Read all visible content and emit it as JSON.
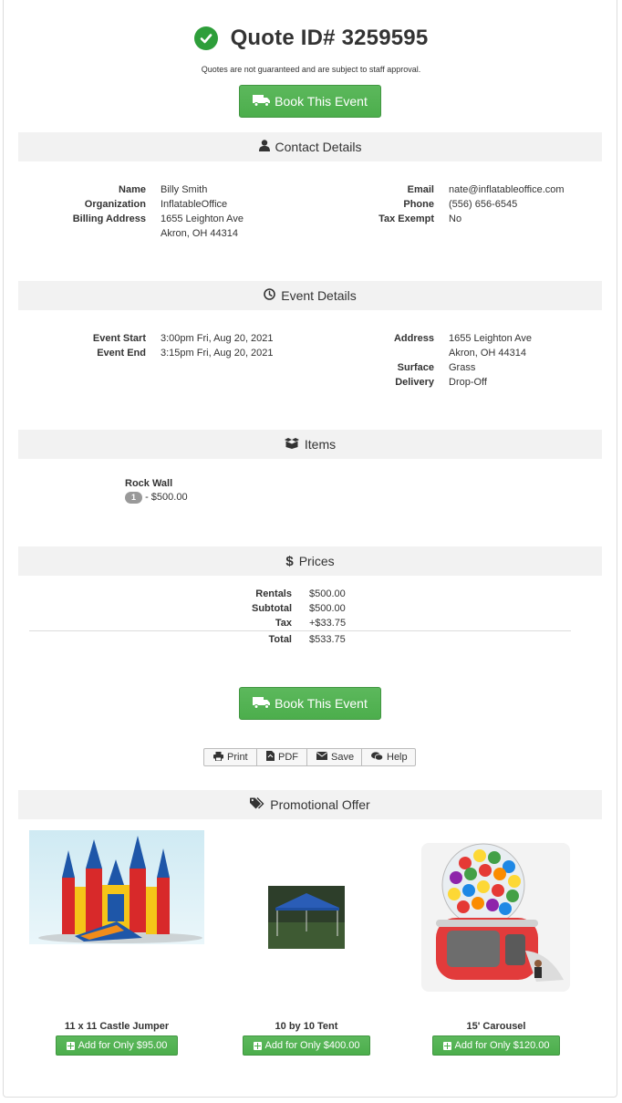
{
  "quote": {
    "title": "Quote ID# 3259595",
    "disclaimer": "Quotes are not guaranteed and are subject to staff approval.",
    "book_label": "Book This Event"
  },
  "contact": {
    "header": "Contact Details",
    "left": [
      {
        "label": "Name",
        "value": "Billy Smith"
      },
      {
        "label": "Organization",
        "value": "InflatableOffice"
      },
      {
        "label": "Billing Address",
        "value": "1655 Leighton Ave"
      },
      {
        "label": "",
        "value": "Akron, OH 44314"
      }
    ],
    "right": [
      {
        "label": "Email",
        "value": "nate@inflatableoffice.com"
      },
      {
        "label": "Phone",
        "value": "(556) 656-6545"
      },
      {
        "label": "Tax Exempt",
        "value": "No"
      }
    ]
  },
  "event": {
    "header": "Event Details",
    "left": [
      {
        "label": "Event Start",
        "value": "3:00pm Fri, Aug 20, 2021"
      },
      {
        "label": "Event End",
        "value": "3:15pm Fri, Aug 20, 2021"
      }
    ],
    "right": [
      {
        "label": "Address",
        "value": "1655 Leighton Ave"
      },
      {
        "label": "",
        "value": "Akron, OH 44314"
      },
      {
        "label": "Surface",
        "value": "Grass"
      },
      {
        "label": "Delivery",
        "value": "Drop-Off"
      }
    ]
  },
  "items": {
    "header": "Items",
    "list": [
      {
        "name": "Rock Wall",
        "qty": "1",
        "price": "- $500.00"
      }
    ]
  },
  "prices": {
    "header": "Prices",
    "rows": [
      {
        "label": "Rentals",
        "value": "$500.00"
      },
      {
        "label": "Subtotal",
        "value": "$500.00"
      },
      {
        "label": "Tax",
        "value": "+$33.75"
      }
    ],
    "total_label": "Total",
    "total_value": "$533.75"
  },
  "actions": {
    "print": "Print",
    "pdf": "PDF",
    "save": "Save",
    "help": "Help"
  },
  "promo": {
    "header": "Promotional Offer",
    "offers": [
      {
        "name": "11 x 11 Castle Jumper",
        "button": "Add for Only $95.00"
      },
      {
        "name": "10 by 10 Tent",
        "button": "Add for Only $400.00"
      },
      {
        "name": "15' Carousel",
        "button": "Add for Only $120.00"
      }
    ]
  },
  "colors": {
    "accent_green": "#5cb85c",
    "section_bg": "#f2f2f2",
    "check_green": "#2e9e3a"
  }
}
